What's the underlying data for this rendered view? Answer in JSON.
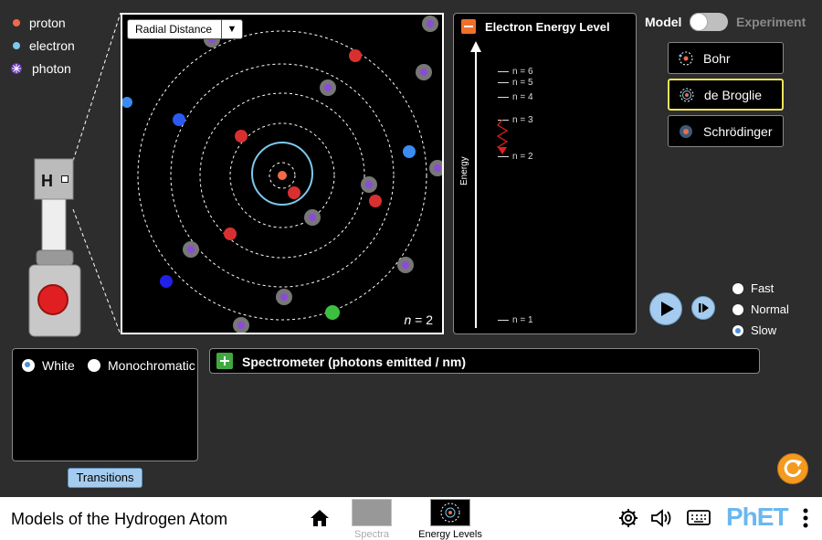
{
  "legend": [
    {
      "label": "proton",
      "color": "#f06a4a"
    },
    {
      "label": "electron",
      "color": "#7ec8ee"
    },
    {
      "label": "photon",
      "color": "#9b5cf0"
    }
  ],
  "gun": {
    "label": "H"
  },
  "view": {
    "dropdown": "Radial Distance",
    "n_label_var": "n",
    "n_label_val": "= 2"
  },
  "energy": {
    "title": "Electron Energy Level",
    "axis_label": "Energy",
    "levels": [
      "n = 6",
      "n = 5",
      "n = 4",
      "n = 3",
      "n = 2",
      "n = 1"
    ]
  },
  "mode": {
    "left": "Model",
    "right": "Experiment"
  },
  "models": [
    {
      "label": "Bohr",
      "selected": false
    },
    {
      "label": "de Broglie",
      "selected": true
    },
    {
      "label": "Schrödinger",
      "selected": false
    }
  ],
  "speeds": [
    {
      "label": "Fast",
      "selected": false
    },
    {
      "label": "Normal",
      "selected": false
    },
    {
      "label": "Slow",
      "selected": true
    }
  ],
  "light": {
    "white": "White",
    "mono": "Monochromatic"
  },
  "transitions": "Transitions",
  "spectrometer": "Spectrometer (photons emitted / nm)",
  "nav": {
    "title": "Models of the Hydrogen Atom",
    "screens": [
      "Spectra",
      "Energy Levels"
    ],
    "brand": "PhET"
  },
  "colors": {
    "accent_orange": "#f06f2a",
    "selection_yellow": "#f0e35c",
    "button_blue": "#a5ccee"
  }
}
